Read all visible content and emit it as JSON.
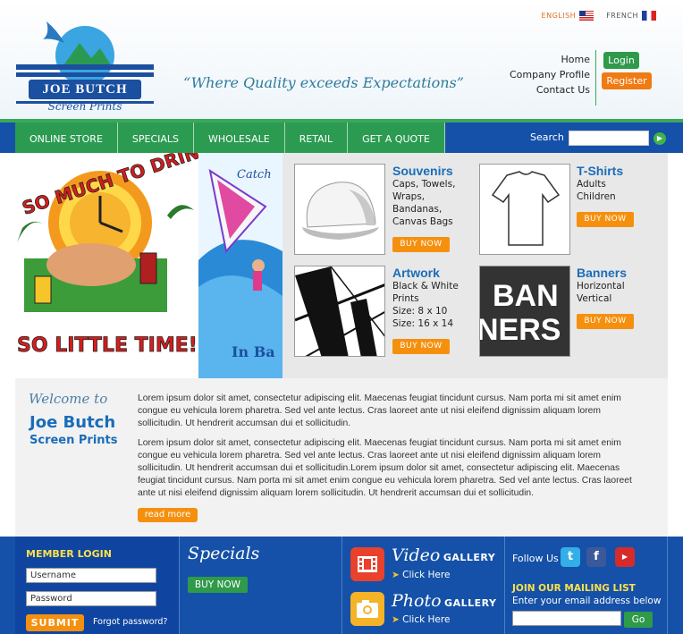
{
  "header": {
    "languages": [
      "ENGLISH",
      "FRENCH"
    ],
    "logo_text": "JOE BUTCH",
    "logo_subtext": "Screen Prints",
    "tagline": "“Where Quality exceeds Expectations”",
    "links": [
      "Home",
      "Company Profile",
      "Contact Us"
    ],
    "login_label": "Login",
    "register_label": "Register"
  },
  "nav": {
    "tabs": [
      "ONLINE STORE",
      "SPECIALS",
      "WHOLESALE",
      "RETAIL",
      "GET A QUOTE"
    ],
    "search_label": "Search"
  },
  "hero": {
    "headline_top": "SO MUCH TO DRINK",
    "headline_bottom": "SO LITTLE TIME!!",
    "second_text": "Catch",
    "second_bottom": "In Ba"
  },
  "products": [
    {
      "title": "Souvenirs",
      "desc": [
        "Caps, Towels,",
        "Wraps,",
        "Bandanas,",
        "Canvas Bags"
      ],
      "buy": "BUY NOW"
    },
    {
      "title": "T-Shirts",
      "desc": [
        "Adults",
        "Children"
      ],
      "buy": "BUY NOW"
    },
    {
      "title": "Artwork",
      "desc": [
        "Black & White",
        "Prints",
        "Size: 8 x 10",
        "Size: 16 x 14"
      ],
      "buy": "BUY NOW"
    },
    {
      "title": "Banners",
      "desc": [
        "Horizontal",
        "Vertical"
      ],
      "buy": "BUY NOW"
    }
  ],
  "banner_thumb_text": [
    "BAN",
    "NERS"
  ],
  "welcome": {
    "welcome_to": "Welcome to",
    "name": "Joe Butch",
    "sub": "Screen Prints",
    "para1": "Lorem ipsum dolor sit amet, consectetur adipiscing elit. Maecenas feugiat tincidunt cursus. Nam porta mi sit amet enim congue eu vehicula lorem pharetra. Sed vel ante lectus. Cras laoreet ante ut nisi eleifend dignissim aliquam lorem sollicitudin. Ut hendrerit accumsan dui et sollicitudin.",
    "para2": "Lorem ipsum dolor sit amet, consectetur adipiscing elit. Maecenas feugiat tincidunt cursus. Nam porta mi sit amet enim congue eu vehicula lorem pharetra. Sed vel ante lectus. Cras laoreet ante ut nisi eleifend dignissim aliquam lorem sollicitudin. Ut hendrerit accumsan dui et sollicitudin.Lorem ipsum dolor sit amet, consectetur adipiscing elit. Maecenas feugiat tincidunt cursus. Nam porta mi sit amet enim congue eu vehicula lorem pharetra. Sed vel ante lectus. Cras laoreet ante ut nisi eleifend dignissim aliquam lorem sollicitudin. Ut hendrerit accumsan dui et sollicitudin.",
    "read_more": "read more"
  },
  "footer": {
    "member_title": "MEMBER LOGIN",
    "username_placeholder": "Username",
    "password_placeholder": "Password",
    "submit": "SUBMIT",
    "forgot": "Forgot password?",
    "specials_title": "Specials",
    "specials_btn": "BUY NOW",
    "video_big": "Video",
    "photo_big": "Photo",
    "gallery_word": "GALLERY",
    "click_here": "Click Here",
    "follow": "Follow Us",
    "mail_title": "JOIN OUR MAILING LIST",
    "mail_sub": "Enter your email address below",
    "go": "Go"
  },
  "colors": {
    "brand_blue": "#1551a8",
    "brand_green": "#2e9a4a",
    "accent_orange": "#f5900f",
    "title_blue": "#1a6db8"
  }
}
